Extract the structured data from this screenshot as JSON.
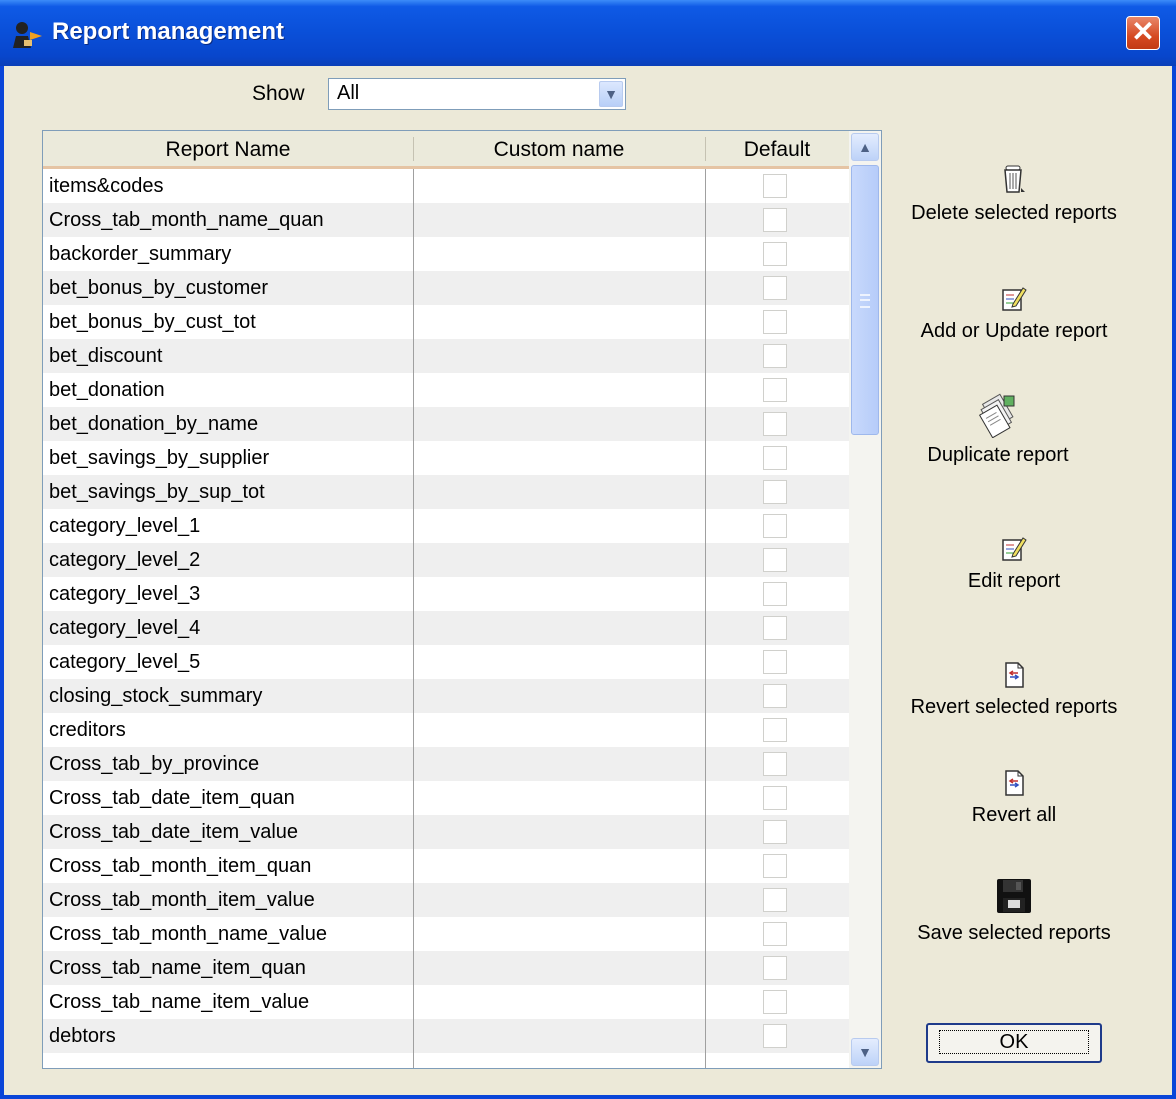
{
  "window": {
    "title": "Report management",
    "close_symbol": "✕"
  },
  "filter": {
    "label": "Show",
    "value": "All"
  },
  "table": {
    "headers": [
      "Report Name",
      "Custom name",
      "Default"
    ],
    "rows": [
      {
        "name": "items&codes",
        "custom": "",
        "default": false
      },
      {
        "name": "Cross_tab_month_name_quan",
        "custom": "",
        "default": false
      },
      {
        "name": "backorder_summary",
        "custom": "",
        "default": false
      },
      {
        "name": "bet_bonus_by_customer",
        "custom": "",
        "default": false
      },
      {
        "name": "bet_bonus_by_cust_tot",
        "custom": "",
        "default": false
      },
      {
        "name": "bet_discount",
        "custom": "",
        "default": false
      },
      {
        "name": "bet_donation",
        "custom": "",
        "default": false
      },
      {
        "name": "bet_donation_by_name",
        "custom": "",
        "default": false
      },
      {
        "name": "bet_savings_by_supplier",
        "custom": "",
        "default": false
      },
      {
        "name": "bet_savings_by_sup_tot",
        "custom": "",
        "default": false
      },
      {
        "name": "category_level_1",
        "custom": "",
        "default": false
      },
      {
        "name": "category_level_2",
        "custom": "",
        "default": false
      },
      {
        "name": "category_level_3",
        "custom": "",
        "default": false
      },
      {
        "name": "category_level_4",
        "custom": "",
        "default": false
      },
      {
        "name": "category_level_5",
        "custom": "",
        "default": false
      },
      {
        "name": "closing_stock_summary",
        "custom": "",
        "default": false
      },
      {
        "name": "creditors",
        "custom": "",
        "default": false
      },
      {
        "name": "Cross_tab_by_province",
        "custom": "",
        "default": false
      },
      {
        "name": "Cross_tab_date_item_quan",
        "custom": "",
        "default": false
      },
      {
        "name": "Cross_tab_date_item_value",
        "custom": "",
        "default": false
      },
      {
        "name": "Cross_tab_month_item_quan",
        "custom": "",
        "default": false
      },
      {
        "name": "Cross_tab_month_item_value",
        "custom": "",
        "default": false
      },
      {
        "name": "Cross_tab_month_name_value",
        "custom": "",
        "default": false
      },
      {
        "name": "Cross_tab_name_item_quan",
        "custom": "",
        "default": false
      },
      {
        "name": "Cross_tab_name_item_value",
        "custom": "",
        "default": false
      },
      {
        "name": "debtors",
        "custom": "",
        "default": false
      }
    ]
  },
  "actions": [
    {
      "id": "delete",
      "label": "Delete selected reports",
      "icon": "trash-can-icon"
    },
    {
      "id": "add-update",
      "label": "Add or Update report",
      "icon": "edit-document-icon"
    },
    {
      "id": "duplicate",
      "label": "Duplicate report",
      "icon": "duplicate-pages-icon"
    },
    {
      "id": "edit",
      "label": "Edit report",
      "icon": "edit-document-icon"
    },
    {
      "id": "revert-selected",
      "label": "Revert selected reports",
      "icon": "revert-document-icon"
    },
    {
      "id": "revert-all",
      "label": "Revert all",
      "icon": "revert-document-icon"
    },
    {
      "id": "save",
      "label": "Save selected reports",
      "icon": "floppy-disk-icon"
    }
  ],
  "ok_label": "OK",
  "colors": {
    "titlebar": "#0A4FD8",
    "window_bg": "#ECE9D8",
    "alt_row": "#EFEFEF",
    "close_button": "#D64A22"
  }
}
